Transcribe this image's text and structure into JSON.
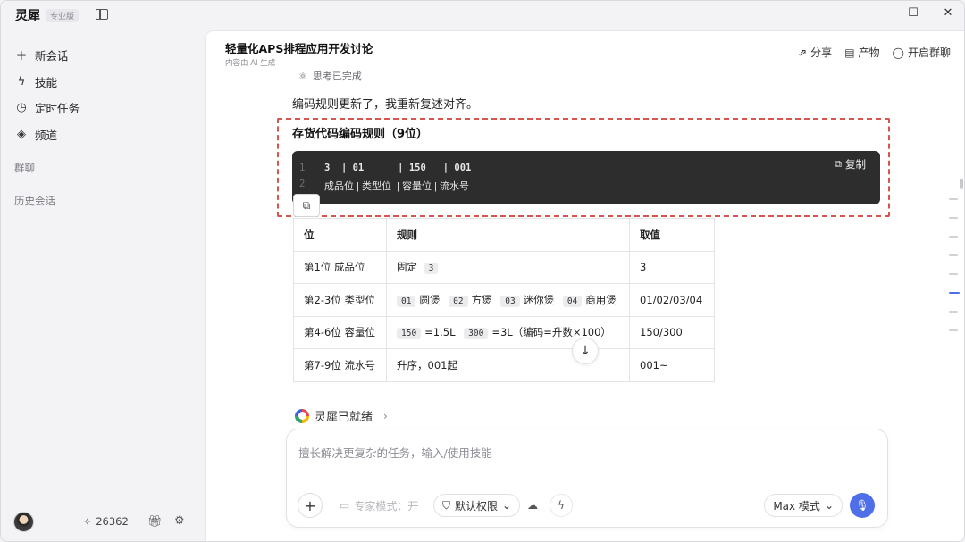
{
  "app": {
    "name": "灵犀",
    "edition": "专业版"
  },
  "sidebar": {
    "items": [
      {
        "icon": "plus-icon",
        "label": "新会话"
      },
      {
        "icon": "lightning-icon",
        "label": "技能"
      },
      {
        "icon": "clock-icon",
        "label": "定时任务"
      },
      {
        "icon": "channel-icon",
        "label": "频道"
      }
    ],
    "group_chat_label": "群聊",
    "history_label": "历史会话",
    "credits": "26362"
  },
  "header": {
    "title": "轻量化APS排程应用开发讨论",
    "subtitle": "内容由 AI 生成",
    "actions": {
      "share": "分享",
      "artifacts": "产物",
      "group_chat": "开启群聊"
    }
  },
  "message": {
    "thinking_status": "思考已完成",
    "intro": "编码规则更新了，我重新复述对齐。",
    "section_title": "存货代码编码规则（9位）",
    "code": {
      "copy_label": "复制",
      "lines": [
        {
          "num": "1",
          "text": "3  | 01      | 150   | 001"
        },
        {
          "num": "2",
          "text": "成品位 | 类型位  | 容量位 | 流水号"
        }
      ]
    },
    "table": {
      "headers": [
        "位",
        "规则",
        "取值"
      ],
      "rows": [
        {
          "pos": "第1位 成品位",
          "rule_prefix": "固定",
          "chip": "3",
          "value": "3"
        },
        {
          "pos": "第2-3位 类型位",
          "chips": [
            {
              "code": "01",
              "label": "圆煲"
            },
            {
              "code": "02",
              "label": "方煲"
            },
            {
              "code": "03",
              "label": "迷你煲"
            },
            {
              "code": "04",
              "label": "商用煲"
            }
          ],
          "value": "01/02/03/04"
        },
        {
          "pos": "第4-6位 容量位",
          "chip_a": "150",
          "text_a": "=1.5L",
          "chip_b": "300",
          "text_b": "=3L（编码=升数×100）",
          "value": "150/300"
        },
        {
          "pos": "第7-9位 流水号",
          "rule": "升序，001起",
          "value": "001~"
        }
      ]
    }
  },
  "status": {
    "ready": "灵犀已就绪"
  },
  "composer": {
    "placeholder": "擅长解决更复杂的任务，输入/使用技能",
    "expert_mode": "专家模式：开",
    "permission": "默认权限",
    "mode": "Max 模式"
  }
}
